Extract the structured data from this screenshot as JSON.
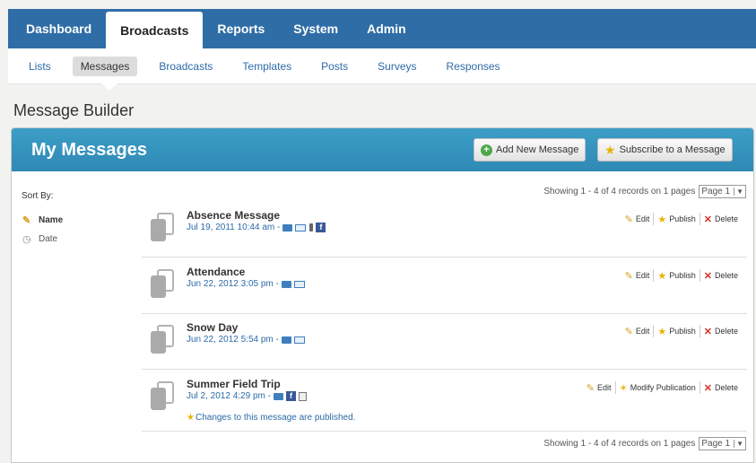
{
  "top_nav": {
    "tabs": [
      {
        "label": "Dashboard"
      },
      {
        "label": "Broadcasts",
        "active": true
      },
      {
        "label": "Reports"
      },
      {
        "label": "System"
      },
      {
        "label": "Admin"
      }
    ]
  },
  "sub_nav": {
    "tabs": [
      {
        "label": "Lists"
      },
      {
        "label": "Messages",
        "active": true
      },
      {
        "label": "Broadcasts"
      },
      {
        "label": "Templates"
      },
      {
        "label": "Posts"
      },
      {
        "label": "Surveys"
      },
      {
        "label": "Responses"
      }
    ]
  },
  "page_title": "Message Builder",
  "panel": {
    "title": "My Messages",
    "add_button": "Add New Message",
    "subscribe_button": "Subscribe to a Message"
  },
  "sidebar": {
    "sort_by_label": "Sort By:",
    "sort_options": [
      {
        "label": "Name",
        "icon": "pencil-icon",
        "active": true
      },
      {
        "label": "Date",
        "icon": "clock-icon"
      }
    ]
  },
  "pagination": {
    "showing_text": "Showing 1 - 4 of 4 records on 1 pages",
    "page_value": "Page 1"
  },
  "messages": [
    {
      "title": "Absence Message",
      "date": "Jul 19, 2011 10:44 am -",
      "channels": [
        "phone",
        "email",
        "text",
        "facebook"
      ],
      "actions": [
        "Edit",
        "Publish",
        "Delete"
      ]
    },
    {
      "title": "Attendance",
      "date": "Jun 22, 2012 3:05 pm -",
      "channels": [
        "phone",
        "email"
      ],
      "actions": [
        "Edit",
        "Publish",
        "Delete"
      ]
    },
    {
      "title": "Snow Day",
      "date": "Jun 22, 2012 5:54 pm -",
      "channels": [
        "phone",
        "email"
      ],
      "actions": [
        "Edit",
        "Publish",
        "Delete"
      ]
    },
    {
      "title": "Summer Field Trip",
      "date": "Jul 2, 2012 4:29 pm -",
      "channels": [
        "phone",
        "facebook",
        "web"
      ],
      "note": "Changes to this message are published.",
      "actions": [
        "Edit",
        "Modify Publication",
        "Delete"
      ]
    }
  ],
  "colors": {
    "nav_blue": "#2f6da6",
    "header_blue": "#3c9ec6",
    "link_blue": "#2c6aa8",
    "delete_red": "#d9302c"
  }
}
